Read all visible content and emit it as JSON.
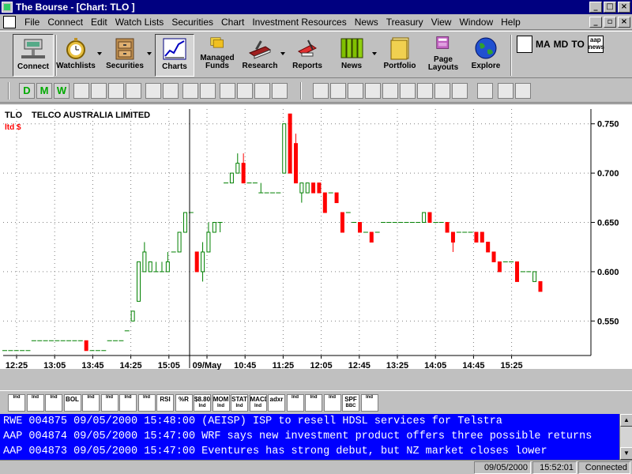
{
  "window": {
    "title": "The Bourse - [Chart: TLO ]"
  },
  "menu": [
    "File",
    "Connect",
    "Edit",
    "Watch Lists",
    "Securities",
    "Chart",
    "Investment Resources",
    "News",
    "Treasury",
    "View",
    "Window",
    "Help"
  ],
  "toolbar": {
    "connect": "Connect",
    "watchlists": "Watchlists",
    "securities": "Securities",
    "charts": "Charts",
    "managed_funds_line1": "Managed",
    "managed_funds_line2": "Funds",
    "research": "Research",
    "reports": "Reports",
    "news": "News",
    "portfolio": "Portfolio",
    "page_layouts_line1": "Page",
    "page_layouts_line2": "Layouts",
    "explore": "Explore",
    "ma": "MA",
    "md": "MD",
    "to": "TO",
    "aap_line1": "aap",
    "aap_line2": "news"
  },
  "chart_toolbar": {
    "d": "D",
    "m": "M",
    "w": "W"
  },
  "chart": {
    "symbol": "TLO",
    "company": "TELCO AUSTRALIA LIMITED",
    "currency": "ltd $",
    "separator_label": "09/May",
    "colors": {
      "up": "#008000",
      "down": "#ff0000",
      "flat": "#008000",
      "background": "#ffffff",
      "grid": "#808080"
    }
  },
  "chart_data": {
    "type": "candlestick",
    "title": "TELCO AUSTRALIA LIMITED",
    "ylabel": "ltd $",
    "ylim": [
      0.515,
      0.765
    ],
    "y_ticks": [
      "0.550",
      "0.600",
      "0.650",
      "0.700",
      "0.750"
    ],
    "x_ticks": [
      "12:25",
      "13:05",
      "13:45",
      "14:25",
      "15:05",
      "09/May",
      "10:45",
      "11:25",
      "12:05",
      "12:45",
      "13:25",
      "14:05",
      "14:45",
      "15:25"
    ],
    "candles": [
      {
        "o": 0.52,
        "h": 0.52,
        "l": 0.52,
        "c": 0.52
      },
      {
        "o": 0.52,
        "h": 0.52,
        "l": 0.52,
        "c": 0.52
      },
      {
        "o": 0.52,
        "h": 0.52,
        "l": 0.52,
        "c": 0.52
      },
      {
        "o": 0.52,
        "h": 0.52,
        "l": 0.52,
        "c": 0.52
      },
      {
        "o": 0.52,
        "h": 0.52,
        "l": 0.52,
        "c": 0.52
      },
      {
        "o": 0.53,
        "h": 0.53,
        "l": 0.53,
        "c": 0.53
      },
      {
        "o": 0.53,
        "h": 0.53,
        "l": 0.53,
        "c": 0.53
      },
      {
        "o": 0.53,
        "h": 0.53,
        "l": 0.53,
        "c": 0.53
      },
      {
        "o": 0.53,
        "h": 0.53,
        "l": 0.53,
        "c": 0.53
      },
      {
        "o": 0.53,
        "h": 0.53,
        "l": 0.53,
        "c": 0.53
      },
      {
        "o": 0.53,
        "h": 0.53,
        "l": 0.53,
        "c": 0.53
      },
      {
        "o": 0.53,
        "h": 0.53,
        "l": 0.53,
        "c": 0.53
      },
      {
        "o": 0.53,
        "h": 0.53,
        "l": 0.53,
        "c": 0.53
      },
      {
        "o": 0.53,
        "h": 0.53,
        "l": 0.53,
        "c": 0.53
      },
      {
        "o": 0.53,
        "h": 0.53,
        "l": 0.52,
        "c": 0.52
      },
      {
        "o": 0.52,
        "h": 0.52,
        "l": 0.52,
        "c": 0.52
      },
      {
        "o": 0.52,
        "h": 0.52,
        "l": 0.52,
        "c": 0.52
      },
      {
        "o": 0.52,
        "h": 0.52,
        "l": 0.52,
        "c": 0.52
      },
      {
        "o": 0.53,
        "h": 0.53,
        "l": 0.53,
        "c": 0.53
      },
      {
        "o": 0.53,
        "h": 0.53,
        "l": 0.53,
        "c": 0.53
      },
      {
        "o": 0.53,
        "h": 0.53,
        "l": 0.53,
        "c": 0.53
      },
      {
        "o": 0.54,
        "h": 0.54,
        "l": 0.54,
        "c": 0.54
      },
      {
        "o": 0.55,
        "h": 0.56,
        "l": 0.55,
        "c": 0.56
      },
      {
        "o": 0.57,
        "h": 0.61,
        "l": 0.57,
        "c": 0.61
      },
      {
        "o": 0.6,
        "h": 0.63,
        "l": 0.6,
        "c": 0.62
      },
      {
        "o": 0.6,
        "h": 0.61,
        "l": 0.6,
        "c": 0.61
      },
      {
        "o": 0.6,
        "h": 0.61,
        "l": 0.6,
        "c": 0.6
      },
      {
        "o": 0.6,
        "h": 0.61,
        "l": 0.6,
        "c": 0.6
      },
      {
        "o": 0.6,
        "h": 0.62,
        "l": 0.6,
        "c": 0.61
      },
      {
        "o": 0.62,
        "h": 0.62,
        "l": 0.62,
        "c": 0.62
      },
      {
        "o": 0.62,
        "h": 0.64,
        "l": 0.62,
        "c": 0.64
      },
      {
        "o": 0.64,
        "h": 0.66,
        "l": 0.64,
        "c": 0.66
      },
      {
        "o": 0.66,
        "h": 0.66,
        "l": 0.66,
        "c": 0.66
      },
      {
        "o": 0.62,
        "h": 0.62,
        "l": 0.6,
        "c": 0.6
      },
      {
        "o": 0.6,
        "h": 0.63,
        "l": 0.59,
        "c": 0.62
      },
      {
        "o": 0.62,
        "h": 0.65,
        "l": 0.62,
        "c": 0.64
      },
      {
        "o": 0.64,
        "h": 0.65,
        "l": 0.64,
        "c": 0.65
      },
      {
        "o": 0.65,
        "h": 0.65,
        "l": 0.64,
        "c": 0.65
      },
      {
        "o": 0.69,
        "h": 0.69,
        "l": 0.69,
        "c": 0.69
      },
      {
        "o": 0.69,
        "h": 0.7,
        "l": 0.69,
        "c": 0.7
      },
      {
        "o": 0.7,
        "h": 0.72,
        "l": 0.7,
        "c": 0.71
      },
      {
        "o": 0.71,
        "h": 0.72,
        "l": 0.69,
        "c": 0.69
      },
      {
        "o": 0.69,
        "h": 0.69,
        "l": 0.69,
        "c": 0.69
      },
      {
        "o": 0.69,
        "h": 0.69,
        "l": 0.69,
        "c": 0.69
      },
      {
        "o": 0.68,
        "h": 0.69,
        "l": 0.68,
        "c": 0.68
      },
      {
        "o": 0.68,
        "h": 0.68,
        "l": 0.68,
        "c": 0.68
      },
      {
        "o": 0.68,
        "h": 0.68,
        "l": 0.68,
        "c": 0.68
      },
      {
        "o": 0.68,
        "h": 0.68,
        "l": 0.68,
        "c": 0.68
      },
      {
        "o": 0.7,
        "h": 0.75,
        "l": 0.7,
        "c": 0.75
      },
      {
        "o": 0.76,
        "h": 0.76,
        "l": 0.7,
        "c": 0.7
      },
      {
        "o": 0.73,
        "h": 0.74,
        "l": 0.69,
        "c": 0.69
      },
      {
        "o": 0.68,
        "h": 0.69,
        "l": 0.67,
        "c": 0.69
      },
      {
        "o": 0.68,
        "h": 0.69,
        "l": 0.68,
        "c": 0.69
      },
      {
        "o": 0.69,
        "h": 0.69,
        "l": 0.68,
        "c": 0.68
      },
      {
        "o": 0.69,
        "h": 0.69,
        "l": 0.68,
        "c": 0.68
      },
      {
        "o": 0.68,
        "h": 0.68,
        "l": 0.66,
        "c": 0.66
      },
      {
        "o": 0.68,
        "h": 0.68,
        "l": 0.68,
        "c": 0.68
      },
      {
        "o": 0.68,
        "h": 0.68,
        "l": 0.67,
        "c": 0.67
      },
      {
        "o": 0.66,
        "h": 0.66,
        "l": 0.64,
        "c": 0.64
      },
      {
        "o": 0.66,
        "h": 0.66,
        "l": 0.66,
        "c": 0.66
      },
      {
        "o": 0.65,
        "h": 0.65,
        "l": 0.65,
        "c": 0.65
      },
      {
        "o": 0.65,
        "h": 0.65,
        "l": 0.64,
        "c": 0.64
      },
      {
        "o": 0.64,
        "h": 0.64,
        "l": 0.64,
        "c": 0.64
      },
      {
        "o": 0.64,
        "h": 0.64,
        "l": 0.63,
        "c": 0.63
      },
      {
        "o": 0.64,
        "h": 0.64,
        "l": 0.64,
        "c": 0.64
      },
      {
        "o": 0.65,
        "h": 0.65,
        "l": 0.65,
        "c": 0.65
      },
      {
        "o": 0.65,
        "h": 0.65,
        "l": 0.65,
        "c": 0.65
      },
      {
        "o": 0.65,
        "h": 0.65,
        "l": 0.65,
        "c": 0.65
      },
      {
        "o": 0.65,
        "h": 0.65,
        "l": 0.65,
        "c": 0.65
      },
      {
        "o": 0.65,
        "h": 0.65,
        "l": 0.65,
        "c": 0.65
      },
      {
        "o": 0.65,
        "h": 0.65,
        "l": 0.65,
        "c": 0.65
      },
      {
        "o": 0.65,
        "h": 0.65,
        "l": 0.65,
        "c": 0.65
      },
      {
        "o": 0.65,
        "h": 0.66,
        "l": 0.65,
        "c": 0.66
      },
      {
        "o": 0.66,
        "h": 0.66,
        "l": 0.65,
        "c": 0.65
      },
      {
        "o": 0.65,
        "h": 0.65,
        "l": 0.65,
        "c": 0.65
      },
      {
        "o": 0.65,
        "h": 0.65,
        "l": 0.65,
        "c": 0.65
      },
      {
        "o": 0.65,
        "h": 0.65,
        "l": 0.64,
        "c": 0.64
      },
      {
        "o": 0.64,
        "h": 0.64,
        "l": 0.62,
        "c": 0.63
      },
      {
        "o": 0.64,
        "h": 0.64,
        "l": 0.64,
        "c": 0.64
      },
      {
        "o": 0.64,
        "h": 0.64,
        "l": 0.64,
        "c": 0.64
      },
      {
        "o": 0.64,
        "h": 0.64,
        "l": 0.64,
        "c": 0.64
      },
      {
        "o": 0.64,
        "h": 0.64,
        "l": 0.63,
        "c": 0.63
      },
      {
        "o": 0.64,
        "h": 0.64,
        "l": 0.63,
        "c": 0.63
      },
      {
        "o": 0.63,
        "h": 0.63,
        "l": 0.62,
        "c": 0.62
      },
      {
        "o": 0.62,
        "h": 0.62,
        "l": 0.61,
        "c": 0.61
      },
      {
        "o": 0.61,
        "h": 0.61,
        "l": 0.6,
        "c": 0.6
      },
      {
        "o": 0.61,
        "h": 0.61,
        "l": 0.61,
        "c": 0.61
      },
      {
        "o": 0.61,
        "h": 0.61,
        "l": 0.61,
        "c": 0.61
      },
      {
        "o": 0.61,
        "h": 0.61,
        "l": 0.59,
        "c": 0.59
      },
      {
        "o": 0.6,
        "h": 0.6,
        "l": 0.6,
        "c": 0.6
      },
      {
        "o": 0.6,
        "h": 0.6,
        "l": 0.6,
        "c": 0.6
      },
      {
        "o": 0.59,
        "h": 0.6,
        "l": 0.59,
        "c": 0.6
      },
      {
        "o": 0.59,
        "h": 0.59,
        "l": 0.58,
        "c": 0.58
      }
    ]
  },
  "indicators": [
    {
      "top": "",
      "bot": "Ind"
    },
    {
      "top": "",
      "bot": "Ind"
    },
    {
      "top": "",
      "bot": "Ind"
    },
    {
      "top": "BOL",
      "bot": ""
    },
    {
      "top": "",
      "bot": "Ind"
    },
    {
      "top": "",
      "bot": "Ind"
    },
    {
      "top": "",
      "bot": "Ind"
    },
    {
      "top": "",
      "bot": "Ind"
    },
    {
      "top": "RSI",
      "bot": ""
    },
    {
      "top": "%R",
      "bot": ""
    },
    {
      "top": "$8.80",
      "bot": "Ind"
    },
    {
      "top": "MOM",
      "bot": "Ind"
    },
    {
      "top": "STAT",
      "bot": "Ind"
    },
    {
      "top": "MACD",
      "bot": "Ind"
    },
    {
      "top": "adxr",
      "bot": ""
    },
    {
      "top": "",
      "bot": "Ind"
    },
    {
      "top": "",
      "bot": "Ind"
    },
    {
      "top": "",
      "bot": "Ind"
    },
    {
      "top": "SPF",
      "bot": "BBC"
    },
    {
      "top": "",
      "bot": "Ind"
    }
  ],
  "news": [
    "RWE 004875 09/05/2000 15:48:00 (AEISP) ISP to resell HDSL services for Telstra",
    "AAP 004874 09/05/2000 15:47:00 WRF says new investment product offers three possible returns",
    "AAP 004873 09/05/2000 15:47:00 Eventures has strong debut, but NZ market closes lower"
  ],
  "status": {
    "date": "09/05/2000",
    "time": "15:52:01",
    "connection": "Connected"
  }
}
